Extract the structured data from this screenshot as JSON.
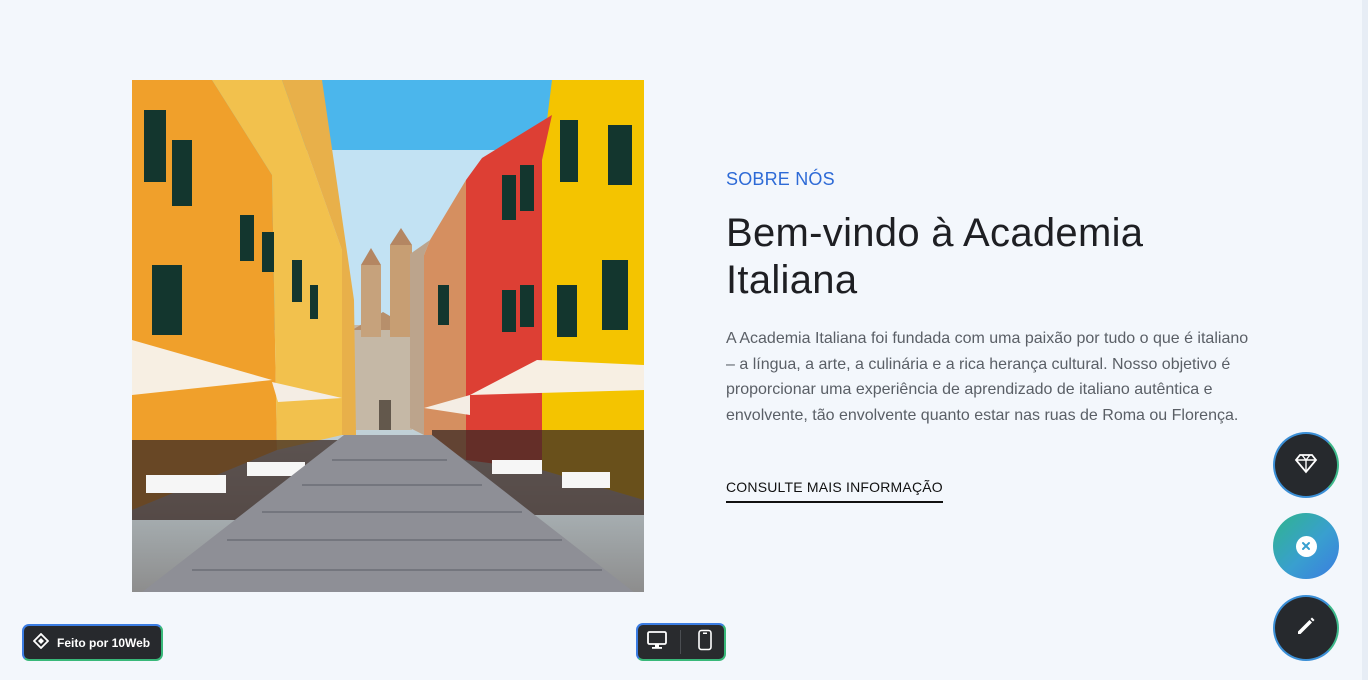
{
  "about": {
    "eyebrow": "SOBRE NÓS",
    "headline": "Bem-vindo à Academia Italiana",
    "body": "A Academia Italiana foi fundada com uma paixão por tudo o que é italiano – a língua, a arte, a culinária e a rica herança cultural. Nosso objetivo é proporcionar uma experiência de aprendizado de italiano autêntica e envolvente, tão envolvente quanto estar nas ruas de Roma ou Florença.",
    "cta_label": "CONSULTE MAIS INFORMAÇÃO"
  },
  "badges": {
    "made_by_label": "Feito por 10Web"
  },
  "device_toggle": {
    "options": [
      "desktop",
      "mobile"
    ]
  },
  "fabs": {
    "icons": [
      "gem-icon",
      "close-icon",
      "pencil-icon"
    ]
  },
  "colors": {
    "background": "#f3f7fc",
    "eyebrow": "#2d6ad6",
    "headline": "#1e1f23",
    "body": "#5a5f66",
    "badge_dark": "#27292d",
    "accent_blue": "#3b7de3",
    "accent_green": "#38b879"
  }
}
